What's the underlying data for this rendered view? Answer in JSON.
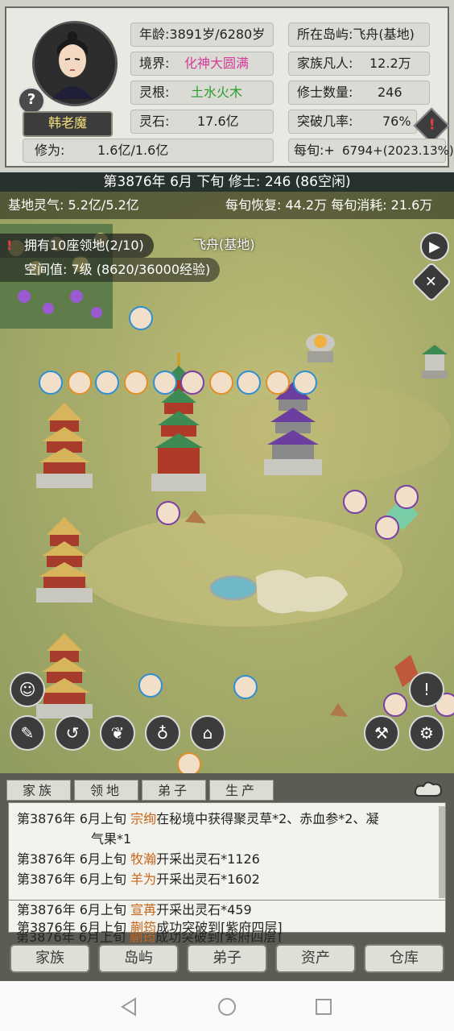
{
  "character": {
    "name": "韩老魔",
    "age_label": "年龄:",
    "age_value": "3891岁/6280岁",
    "realm_label": "境界:",
    "realm_value": "化神大圆满",
    "root_label": "灵根:",
    "root_value": "土水火木",
    "stones_label": "灵石:",
    "stones_value": "17.6亿",
    "island_label": "所在岛屿:",
    "island_value": "飞舟(基地)",
    "mortals_label": "家族凡人:",
    "mortals_value": "12.2万",
    "cultivators_label": "修士数量:",
    "cultivators_value": "246",
    "breakthrough_label": "突破几率:",
    "breakthrough_value": "76%",
    "cultivation_label": "修为:",
    "cultivation_value": "1.6亿/1.6亿",
    "per_xun_label": "每旬:+",
    "per_xun_value": "6794+(2023.13%)",
    "colors": {
      "realm": "#d63b9a",
      "root": "#2a9d2a"
    }
  },
  "date_bar": "第3876年 6月 下旬   修士: 246 (86空闲)",
  "map": {
    "base_qi": "基地灵气: 5.2亿/5.2亿",
    "recovery": "每旬恢复: 44.2万 每旬消耗: 21.6万",
    "territory": "拥有10座领地(2/10)",
    "space_value": "空间值: 7级 (8620/36000经验)",
    "location": "飞舟(基地)"
  },
  "log": {
    "tabs": [
      "家族",
      "领地",
      "弟子",
      "生产"
    ],
    "entries": [
      {
        "date": "第3876年 6月上旬 ",
        "name": "宗绚",
        "text": "在秘境中获得聚灵草*2、赤血参*2、凝",
        "cont": "气果*1"
      },
      {
        "date": "第3876年 6月上旬 ",
        "name": "牧瀚",
        "text": "开采出灵石*1126"
      },
      {
        "date": "第3876年 6月上旬 ",
        "name": "羊为",
        "text": "开采出灵石*1602"
      },
      {
        "date": "第3876年 6月上旬 ",
        "name": "宣苒",
        "text": "开采出灵石*459"
      },
      {
        "date": "第3876年 6月上旬 ",
        "name": "蒯筠",
        "text": "成功突破到[紫府四层]"
      }
    ]
  },
  "nav": [
    "家族",
    "岛屿",
    "弟子",
    "资产",
    "仓库"
  ]
}
